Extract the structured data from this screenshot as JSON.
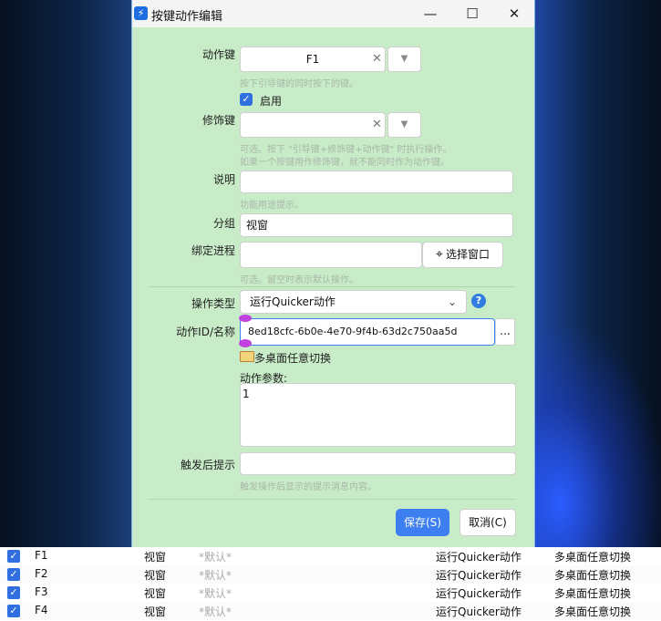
{
  "window": {
    "title": "按键动作编辑",
    "minimize": "—",
    "maximize": "☐",
    "close": "✕"
  },
  "form": {
    "action_key": {
      "label": "动作键",
      "value": "F1",
      "hint": "按下引导键的同时按下的键。"
    },
    "enabled": {
      "label": "启用",
      "checked": true
    },
    "modifier_key": {
      "label": "修饰键",
      "value": "",
      "hint_line1": "可选。按下 \"引导键+修饰键+动作键\" 时执行操作。",
      "hint_line2": "如果一个按键用作修饰键，就不能同时作为动作键。"
    },
    "description": {
      "label": "说明",
      "value": "",
      "hint": "功能用途提示。"
    },
    "group": {
      "label": "分组",
      "value": "视窗"
    },
    "bind_process": {
      "label": "绑定进程",
      "value": "",
      "button": "选择窗口",
      "hint": "可选。留空时表示默认操作。"
    },
    "op_type": {
      "label": "操作类型",
      "value": "运行Quicker动作"
    },
    "action_id": {
      "label": "动作ID/名称",
      "value": "8ed18cfc-6b0e-4e70-9f4b-63d2c750aa5d",
      "browse": "...",
      "resolved_name": "多桌面任意切换"
    },
    "action_params": {
      "label": "动作参数:",
      "value": "1"
    },
    "trigger_tip": {
      "label": "触发后提示",
      "value": "",
      "hint": "触发操作后显示的提示消息内容。"
    },
    "save_button": "保存(S)",
    "cancel_button": "取消(C)"
  },
  "table": {
    "rows": [
      {
        "key": "F1",
        "group": "视窗",
        "process": "*默认*",
        "type": "运行Quicker动作",
        "name": "多桌面任意切换"
      },
      {
        "key": "F2",
        "group": "视窗",
        "process": "*默认*",
        "type": "运行Quicker动作",
        "name": "多桌面任意切换"
      },
      {
        "key": "F3",
        "group": "视窗",
        "process": "*默认*",
        "type": "运行Quicker动作",
        "name": "多桌面任意切换"
      },
      {
        "key": "F4",
        "group": "视窗",
        "process": "*默认*",
        "type": "运行Quicker动作",
        "name": "多桌面任意切换"
      }
    ]
  },
  "colors": {
    "dialog_bg": "#c8ebc8",
    "accent": "#3d7ef0"
  }
}
